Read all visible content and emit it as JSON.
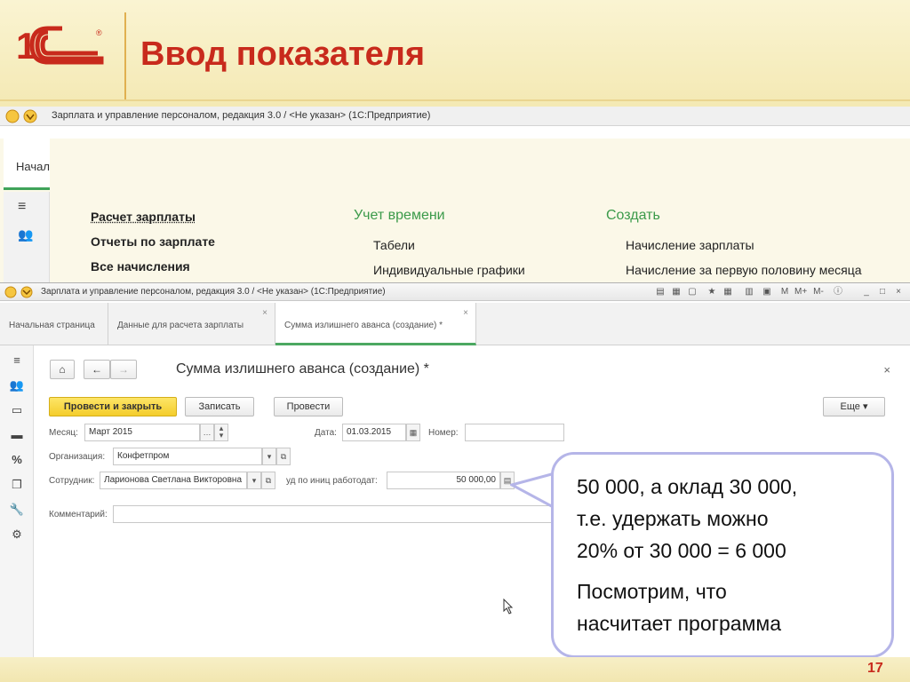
{
  "slide": {
    "title": "Ввод показателя",
    "page_number": "17",
    "logo_text": "1С"
  },
  "background_window": {
    "title": "Зарплата и управление персоналом, редакция 3.0 / <Не указан>  (1С:Предприятие)",
    "tab_label": "Начал",
    "links_col1": [
      "Расчет зарплаты",
      "Отчеты по зарплате",
      "Все начисления"
    ],
    "heading_col2": "Учет времени",
    "links_col2": [
      "Табели",
      "Индивидуальные графики"
    ],
    "heading_col3": "Создать",
    "links_col3": [
      "Начисление зарплаты",
      "Начисление за первую половину месяца"
    ]
  },
  "window": {
    "title": "Зарплата и управление персоналом, редакция 3.0 / <Не указан>  (1С:Предприятие)",
    "tabs": [
      {
        "label": "Начальная страница"
      },
      {
        "label": "Данные для расчета зарплаты"
      },
      {
        "label": "Сумма излишнего аванса (создание) *"
      }
    ]
  },
  "form": {
    "title": "Сумма излишнего аванса (создание) *",
    "buttons": {
      "post_close": "Провести и закрыть",
      "save": "Записать",
      "post": "Провести",
      "more": "Еще"
    },
    "fields": {
      "month_label": "Месяц:",
      "month_value": "Март 2015",
      "date_label": "Дата:",
      "date_value": "01.03.2015",
      "number_label": "Номер:",
      "number_value": "",
      "org_label": "Организация:",
      "org_value": "Конфетпром",
      "employee_label": "Сотрудник:",
      "employee_value": "Ларионова Светлана Викторовна",
      "withheld_label": "уд по иниц работодат:",
      "withheld_value": "50 000,00",
      "comment_label": "Комментарий:",
      "comment_value": ""
    }
  },
  "callout": {
    "line1": "50 000, а оклад 30 000,",
    "line2": "т.е. удержать можно",
    "line3": "20% от 30 000 = 6 000",
    "line4": "Посмотрим, что",
    "line5": "насчитает программа"
  },
  "colors": {
    "title_red": "#c82a1c",
    "accent_green": "#3b9a4a",
    "primary_button": "#f4cd2b",
    "callout_border": "#b5b5e8"
  }
}
